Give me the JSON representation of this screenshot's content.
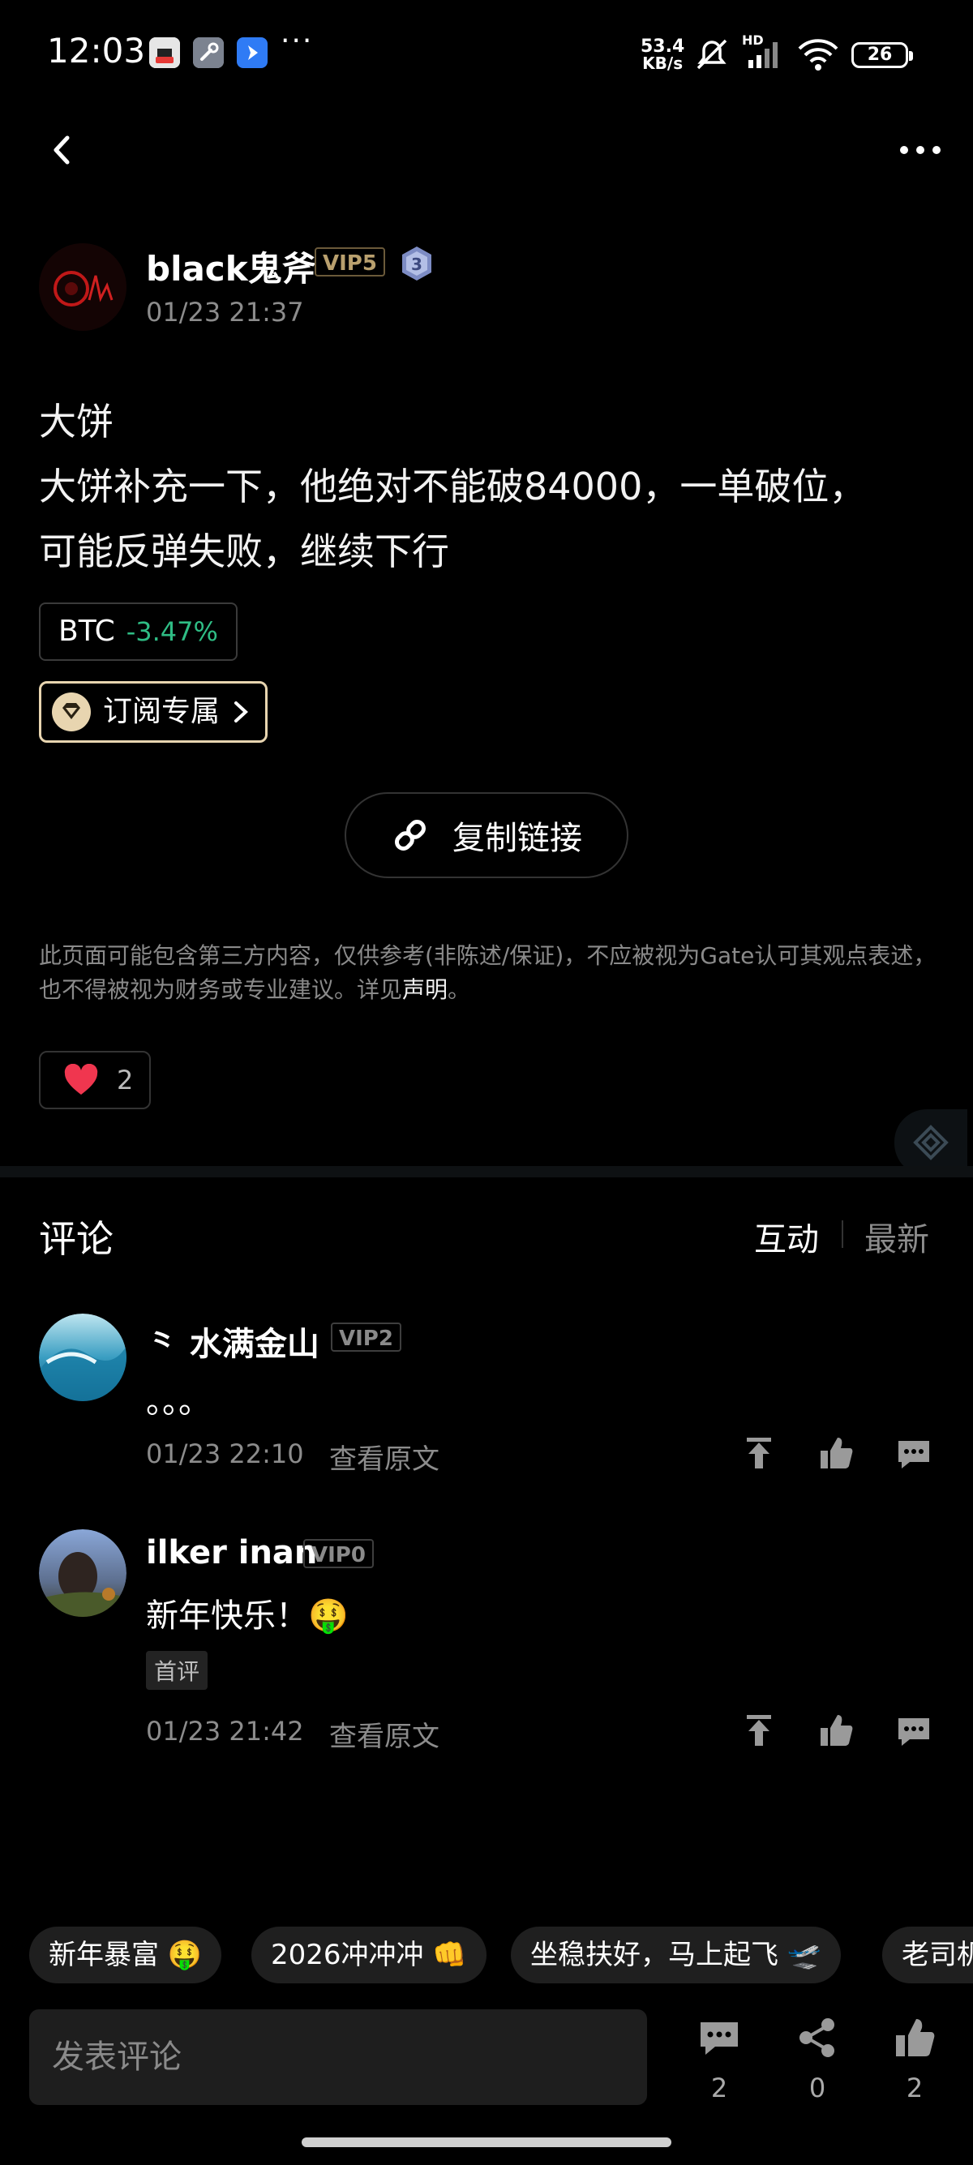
{
  "status_bar": {
    "time": "12:03",
    "net_speed_value": "53.4",
    "net_speed_unit": "KB/s",
    "network": "HD",
    "battery": "26"
  },
  "post": {
    "author": "black鬼斧",
    "vip": "VIP5",
    "level": "3",
    "time": "01/23 21:37",
    "lines": [
      "大饼",
      "大饼补充一下，他绝对不能破84000，一单破位，",
      "可能反弹失败，继续下行"
    ],
    "coin": "BTC",
    "coin_change": "-3.47%",
    "subscribe_label": "订阅专属",
    "copy_link_label": "复制链接",
    "disclaimer": "此页面可能包含第三方内容，仅供参考(非陈述/保证)，不应被视为Gate认可其观点表述，也不得被视为财务或专业建议。详见",
    "disclaimer_link": "声明",
    "disclaimer_end": "。",
    "likes": "2"
  },
  "comments_section": {
    "title": "评论",
    "sort_active": "互动",
    "sort_other": "最新",
    "view_original": "查看原文",
    "items": [
      {
        "name": "⺀ 水满金山",
        "vip": "VIP2",
        "text": "。。。",
        "time": "01/23 22:10"
      },
      {
        "name": "ilker inan",
        "vip": "VIP0",
        "text": "新年快乐！🤑",
        "tag": "首评",
        "time": "01/23 21:42"
      }
    ]
  },
  "quick_replies": [
    "新年暴富 🤑",
    "2026冲冲冲 👊",
    "坐稳扶好，马上起飞 🛫",
    "老司机"
  ],
  "bottom_bar": {
    "input_placeholder": "发表评论",
    "comment_count": "2",
    "share_count": "0",
    "like_count": "2"
  },
  "colors": {
    "background": "#000000",
    "positive": "#2fbd85",
    "subscribe_border": "#e8d5b0",
    "heart": "#f0364f"
  }
}
